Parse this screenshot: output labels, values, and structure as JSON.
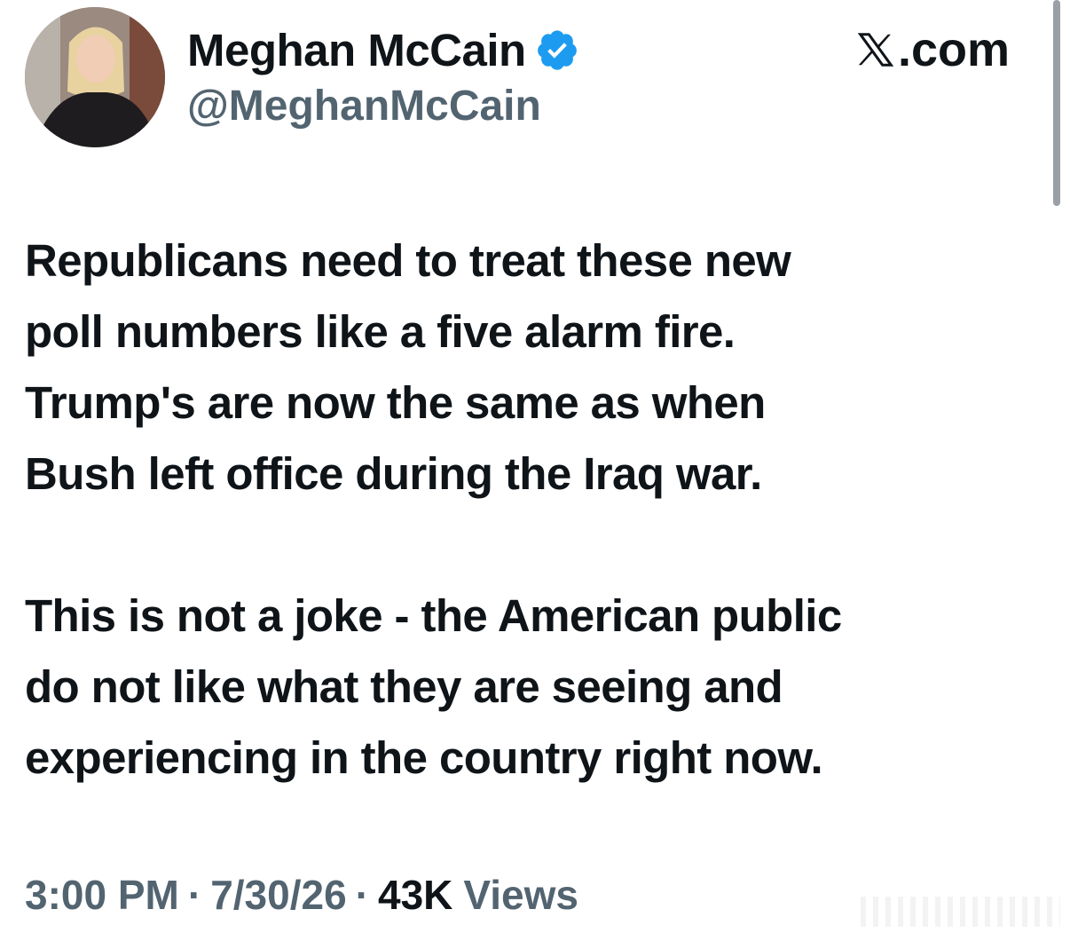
{
  "header": {
    "display_name": "Meghan McCain",
    "handle": "@MeghanMcCain",
    "site_label": ".com",
    "site_icon": "x-logo-icon",
    "verified_icon": "verified-badge-icon",
    "accent_color": "#1d9bf0"
  },
  "tweet": {
    "paragraph1_lines": [
      "Republicans need to treat these new",
      "poll numbers like a five alarm fire.",
      "Trump's are now the same as when",
      "Bush left office during the Iraq war."
    ],
    "paragraph2_lines": [
      "This is not a joke - the American public",
      "do not like what they are seeing and",
      "experiencing in the country right now."
    ]
  },
  "meta": {
    "time": "3:00 PM",
    "separator": "·",
    "date": "7/30/26",
    "views_count": "43K",
    "views_label": "Views"
  }
}
